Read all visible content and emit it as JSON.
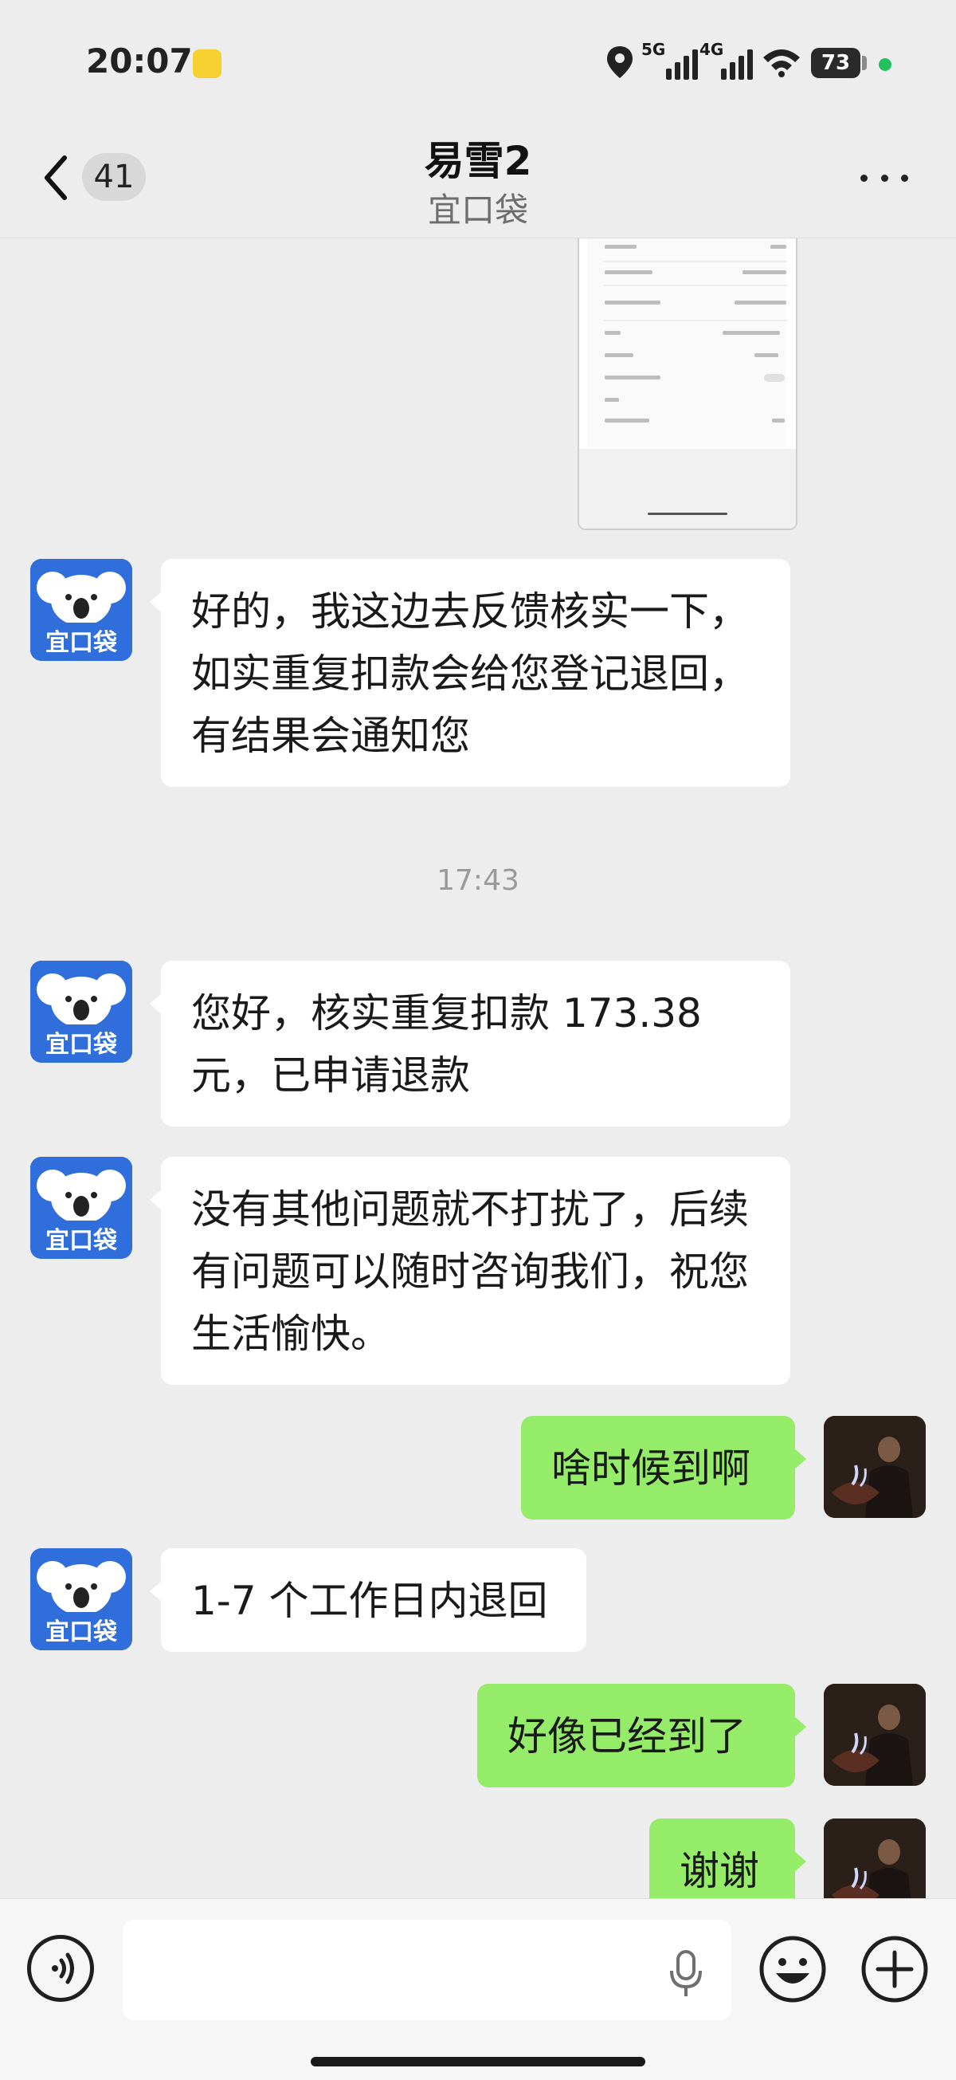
{
  "status_bar": {
    "time": "20:07",
    "network_1": "5G",
    "network_2": "4G",
    "battery": "73"
  },
  "nav": {
    "unread_count": "41",
    "title": "易雪2",
    "subtitle": "宜口袋"
  },
  "contact": {
    "avatar_label": "宜口袋",
    "avatar_color": "#2f6edb"
  },
  "messages": [
    {
      "from": "them",
      "text": "好的，我这边去反馈核实一下，如实重复扣款会给您登记退回，有结果会通知您"
    },
    {
      "type": "time",
      "text": "17:43"
    },
    {
      "from": "them",
      "text": "您好，核实重复扣款 173.38 元，已申请退款"
    },
    {
      "from": "them",
      "text": "没有其他问题就不打扰了，后续有问题可以随时咨询我们，祝您生活愉快。"
    },
    {
      "from": "me",
      "text": "啥时候到啊"
    },
    {
      "from": "them",
      "text": "1-7 个工作日内退回"
    },
    {
      "from": "me",
      "text": "好像已经到了"
    },
    {
      "from": "me",
      "text": "谢谢"
    }
  ],
  "input": {
    "value": "",
    "placeholder": ""
  },
  "colors": {
    "background": "#ededed",
    "incoming_bubble": "#ffffff",
    "outgoing_bubble": "#95ec69",
    "status_dot": "#21c25e"
  }
}
